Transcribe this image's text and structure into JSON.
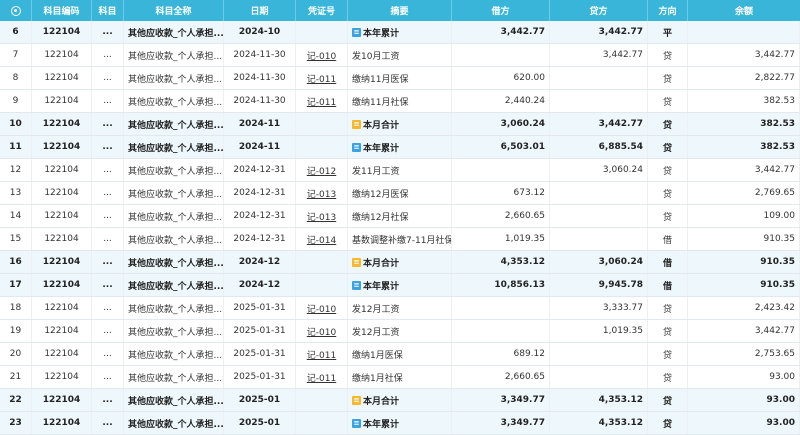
{
  "headers": {
    "seq": "",
    "code": "科目编码",
    "subject": "科目",
    "fullname": "科目全称",
    "date": "日期",
    "voucher": "凭证号",
    "summary": "摘要",
    "debit": "借方",
    "credit": "贷方",
    "direction": "方向",
    "balance": "余额"
  },
  "rows": [
    {
      "seq": "6",
      "code": "122104",
      "subj": "...",
      "name": "其他应收款_个人承担...",
      "date": "2024-10",
      "voucher": "",
      "summary": "本年累计",
      "tag": "blue",
      "debit": "3,442.77",
      "credit": "3,442.77",
      "dir": "平",
      "balance": "",
      "sum": true
    },
    {
      "seq": "7",
      "code": "122104",
      "subj": "...",
      "name": "其他应收款_个人承担...",
      "date": "2024-11-30",
      "voucher": "记-010",
      "summary": "发10月工资",
      "tag": "",
      "debit": "",
      "credit": "3,442.77",
      "dir": "贷",
      "balance": "3,442.77",
      "sum": false
    },
    {
      "seq": "8",
      "code": "122104",
      "subj": "...",
      "name": "其他应收款_个人承担...",
      "date": "2024-11-30",
      "voucher": "记-011",
      "summary": "缴纳11月医保",
      "tag": "",
      "debit": "620.00",
      "credit": "",
      "dir": "贷",
      "balance": "2,822.77",
      "sum": false
    },
    {
      "seq": "9",
      "code": "122104",
      "subj": "...",
      "name": "其他应收款_个人承担...",
      "date": "2024-11-30",
      "voucher": "记-011",
      "summary": "缴纳11月社保",
      "tag": "",
      "debit": "2,440.24",
      "credit": "",
      "dir": "贷",
      "balance": "382.53",
      "sum": false
    },
    {
      "seq": "10",
      "code": "122104",
      "subj": "...",
      "name": "其他应收款_个人承担...",
      "date": "2024-11",
      "voucher": "",
      "summary": "本月合计",
      "tag": "yellow",
      "debit": "3,060.24",
      "credit": "3,442.77",
      "dir": "贷",
      "balance": "382.53",
      "sum": true
    },
    {
      "seq": "11",
      "code": "122104",
      "subj": "...",
      "name": "其他应收款_个人承担...",
      "date": "2024-11",
      "voucher": "",
      "summary": "本年累计",
      "tag": "blue",
      "debit": "6,503.01",
      "credit": "6,885.54",
      "dir": "贷",
      "balance": "382.53",
      "sum": true
    },
    {
      "seq": "12",
      "code": "122104",
      "subj": "...",
      "name": "其他应收款_个人承担...",
      "date": "2024-12-31",
      "voucher": "记-012",
      "summary": "发11月工资",
      "tag": "",
      "debit": "",
      "credit": "3,060.24",
      "dir": "贷",
      "balance": "3,442.77",
      "sum": false
    },
    {
      "seq": "13",
      "code": "122104",
      "subj": "...",
      "name": "其他应收款_个人承担...",
      "date": "2024-12-31",
      "voucher": "记-013",
      "summary": "缴纳12月医保",
      "tag": "",
      "debit": "673.12",
      "credit": "",
      "dir": "贷",
      "balance": "2,769.65",
      "sum": false
    },
    {
      "seq": "14",
      "code": "122104",
      "subj": "...",
      "name": "其他应收款_个人承担...",
      "date": "2024-12-31",
      "voucher": "记-013",
      "summary": "缴纳12月社保",
      "tag": "",
      "debit": "2,660.65",
      "credit": "",
      "dir": "贷",
      "balance": "109.00",
      "sum": false
    },
    {
      "seq": "15",
      "code": "122104",
      "subj": "...",
      "name": "其他应收款_个人承担...",
      "date": "2024-12-31",
      "voucher": "记-014",
      "summary": "基数调整补缴7-11月社保",
      "tag": "",
      "debit": "1,019.35",
      "credit": "",
      "dir": "借",
      "balance": "910.35",
      "sum": false
    },
    {
      "seq": "16",
      "code": "122104",
      "subj": "...",
      "name": "其他应收款_个人承担...",
      "date": "2024-12",
      "voucher": "",
      "summary": "本月合计",
      "tag": "yellow",
      "debit": "4,353.12",
      "credit": "3,060.24",
      "dir": "借",
      "balance": "910.35",
      "sum": true
    },
    {
      "seq": "17",
      "code": "122104",
      "subj": "...",
      "name": "其他应收款_个人承担...",
      "date": "2024-12",
      "voucher": "",
      "summary": "本年累计",
      "tag": "blue",
      "debit": "10,856.13",
      "credit": "9,945.78",
      "dir": "借",
      "balance": "910.35",
      "sum": true
    },
    {
      "seq": "18",
      "code": "122104",
      "subj": "...",
      "name": "其他应收款_个人承担...",
      "date": "2025-01-31",
      "voucher": "记-010",
      "summary": "发12月工资",
      "tag": "",
      "debit": "",
      "credit": "3,333.77",
      "dir": "贷",
      "balance": "2,423.42",
      "sum": false
    },
    {
      "seq": "19",
      "code": "122104",
      "subj": "...",
      "name": "其他应收款_个人承担...",
      "date": "2025-01-31",
      "voucher": "记-010",
      "summary": "发12月工资",
      "tag": "",
      "debit": "",
      "credit": "1,019.35",
      "dir": "贷",
      "balance": "3,442.77",
      "sum": false
    },
    {
      "seq": "20",
      "code": "122104",
      "subj": "...",
      "name": "其他应收款_个人承担...",
      "date": "2025-01-31",
      "voucher": "记-011",
      "summary": "缴纳1月医保",
      "tag": "",
      "debit": "689.12",
      "credit": "",
      "dir": "贷",
      "balance": "2,753.65",
      "sum": false
    },
    {
      "seq": "21",
      "code": "122104",
      "subj": "...",
      "name": "其他应收款_个人承担...",
      "date": "2025-01-31",
      "voucher": "记-011",
      "summary": "缴纳1月社保",
      "tag": "",
      "debit": "2,660.65",
      "credit": "",
      "dir": "贷",
      "balance": "93.00",
      "sum": false
    },
    {
      "seq": "22",
      "code": "122104",
      "subj": "...",
      "name": "其他应收款_个人承担...",
      "date": "2025-01",
      "voucher": "",
      "summary": "本月合计",
      "tag": "yellow",
      "debit": "3,349.77",
      "credit": "4,353.12",
      "dir": "贷",
      "balance": "93.00",
      "sum": true
    },
    {
      "seq": "23",
      "code": "122104",
      "subj": "...",
      "name": "其他应收款_个人承担...",
      "date": "2025-01",
      "voucher": "",
      "summary": "本年累计",
      "tag": "blue",
      "debit": "3,349.77",
      "credit": "4,353.12",
      "dir": "贷",
      "balance": "93.00",
      "sum": true
    }
  ]
}
